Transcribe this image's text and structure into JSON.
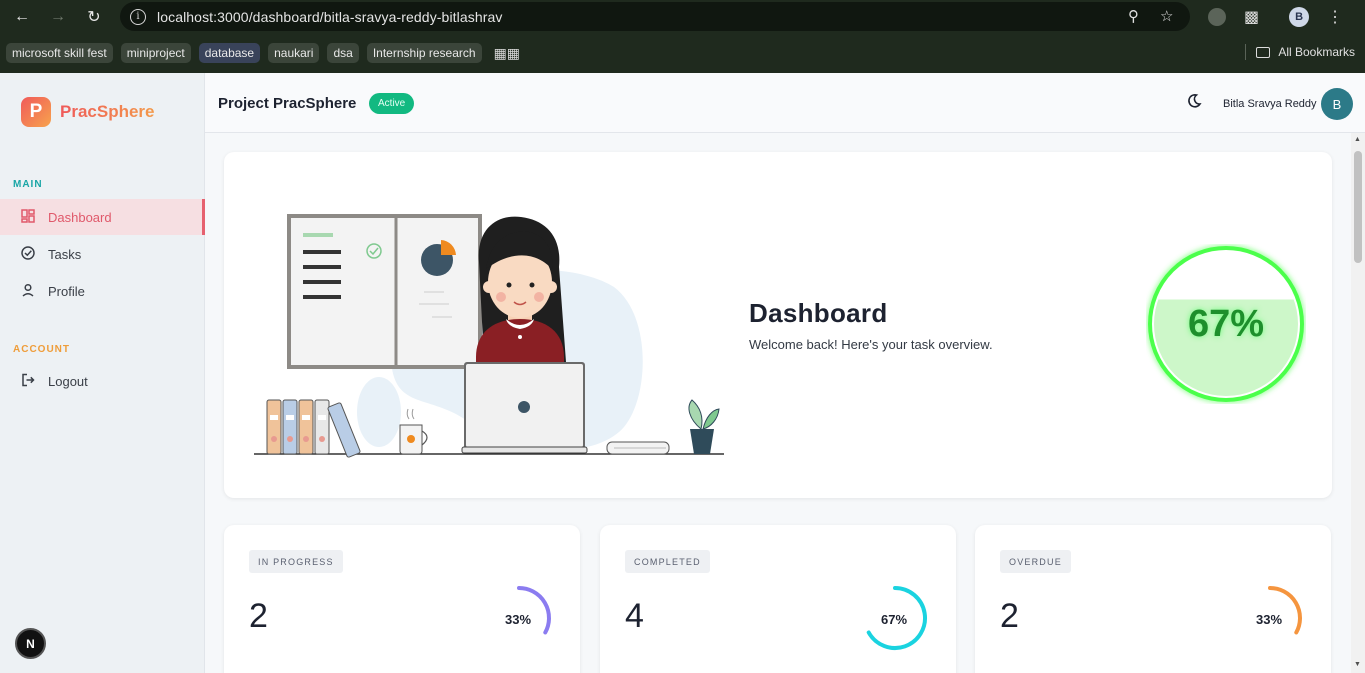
{
  "browser": {
    "url": "localhost:3000/dashboard/bitla-sravya-reddy-bitlashrav",
    "profile_initial": "B",
    "bookmarks": [
      "microsoft skill fest",
      "miniproject",
      "database",
      "naukari",
      "dsa",
      "Internship research"
    ],
    "all_bookmarks_label": "All Bookmarks"
  },
  "sidebar": {
    "brand_mark": "P",
    "brand": "PracSphere",
    "main_label": "MAIN",
    "account_label": "ACCOUNT",
    "items": [
      {
        "label": "Dashboard",
        "icon": "dashboard-icon",
        "active": true
      },
      {
        "label": "Tasks",
        "icon": "check-circle-icon",
        "active": false
      },
      {
        "label": "Profile",
        "icon": "user-icon",
        "active": false
      }
    ],
    "logout_label": "Logout",
    "badge": "N"
  },
  "header": {
    "project_title": "Project PracSphere",
    "status": "Active",
    "user_name": "Bitla Sravya Reddy",
    "user_initial": "B"
  },
  "hero": {
    "title": "Dashboard",
    "subtitle": "Welcome back! Here's your task overview.",
    "progress_label": "67%",
    "progress_value": 0.67
  },
  "stats": [
    {
      "tag": "IN PROGRESS",
      "value": "2",
      "pct_label": "33%",
      "pct": 0.33,
      "color": "#8b7cf0"
    },
    {
      "tag": "COMPLETED",
      "value": "4",
      "pct_label": "67%",
      "pct": 0.67,
      "color": "#1ad3e0"
    },
    {
      "tag": "OVERDUE",
      "value": "2",
      "pct_label": "33%",
      "pct": 0.33,
      "color": "#f5953f"
    }
  ],
  "colors": {
    "accent": "#e6616f",
    "success": "#12b981",
    "progress_glow": "#4cff4c"
  }
}
